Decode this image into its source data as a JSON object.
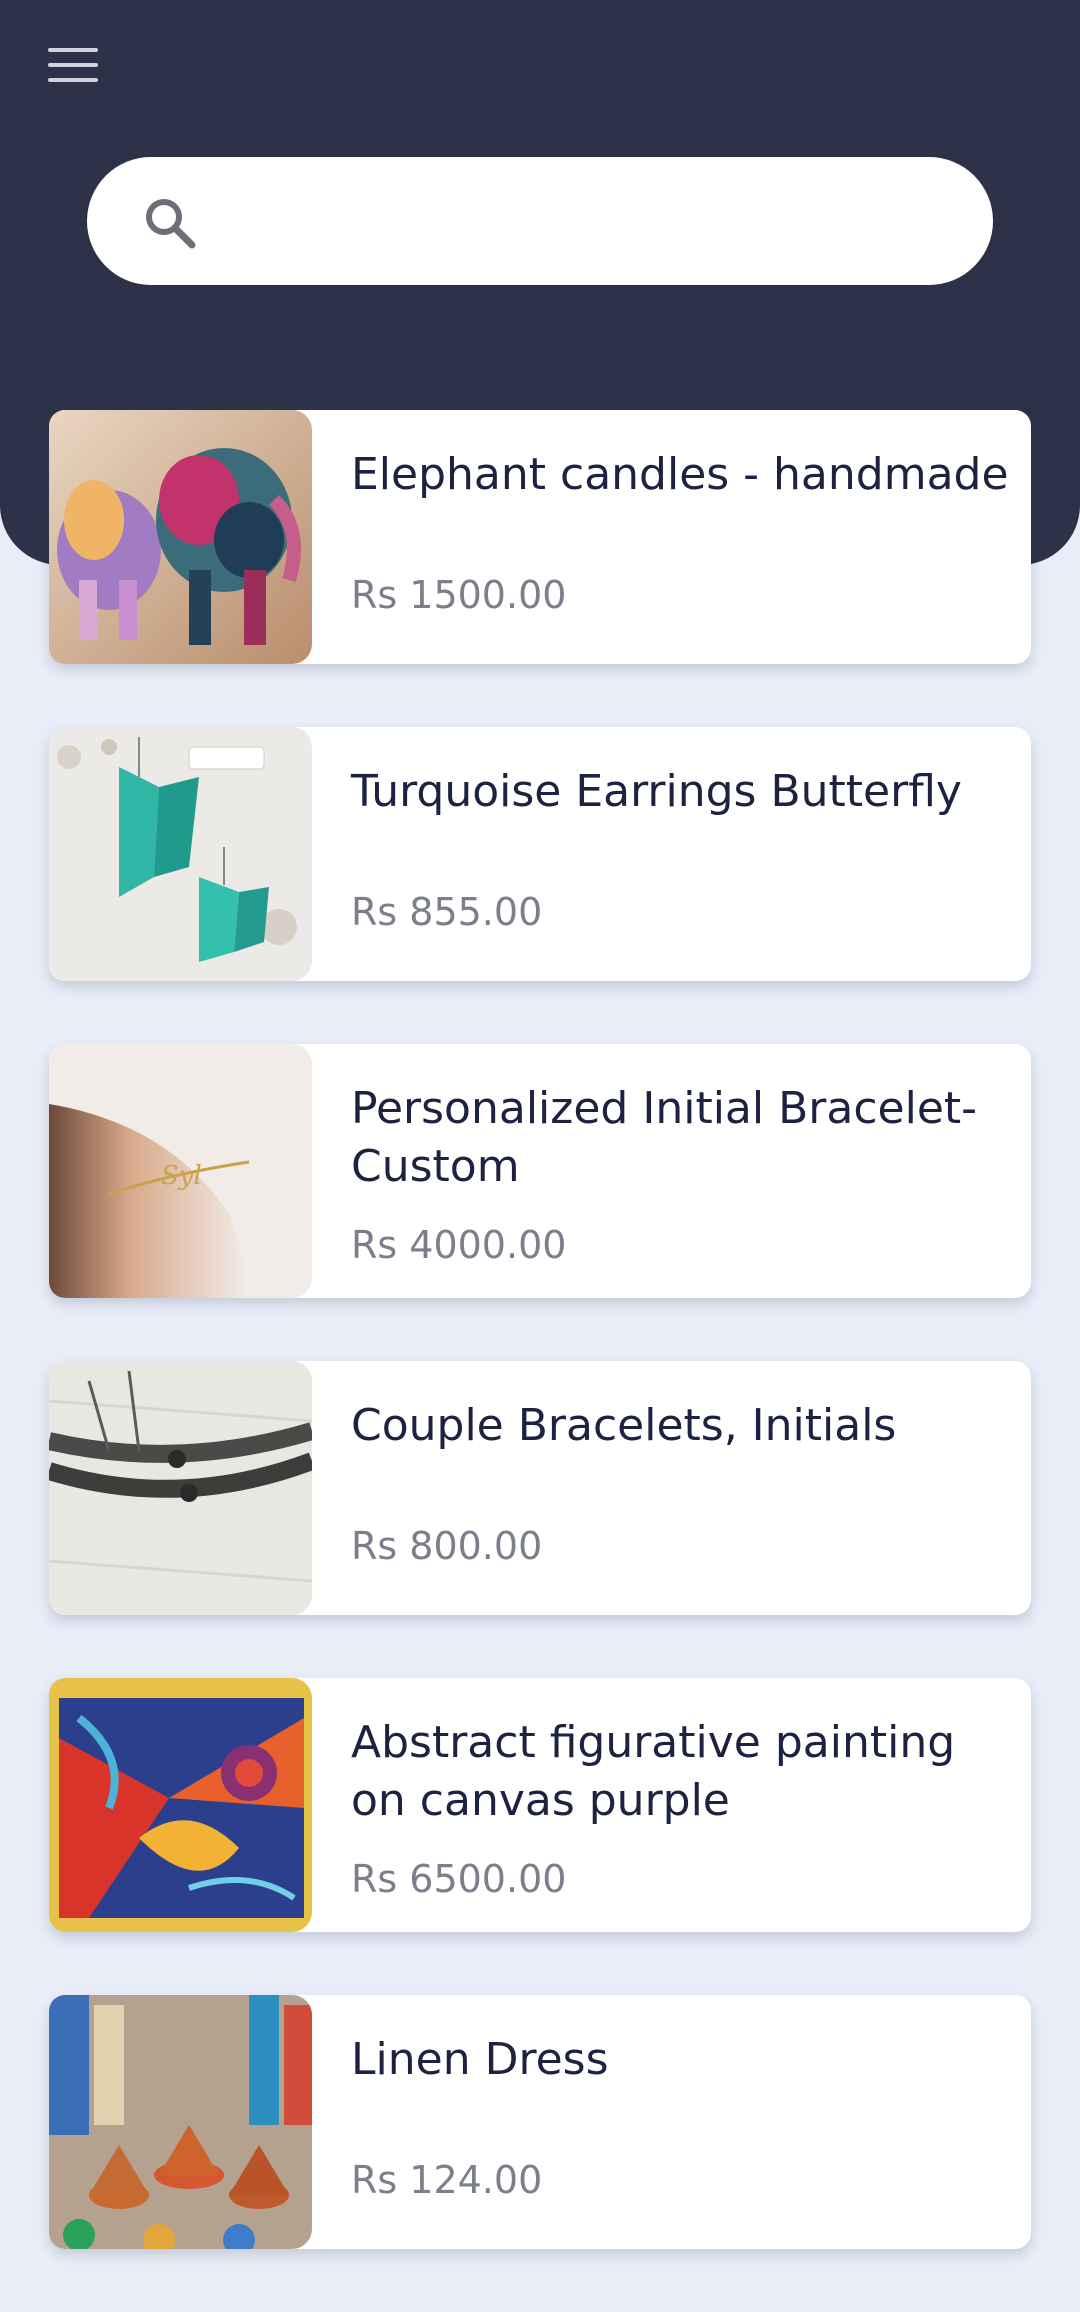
{
  "header": {
    "menu_icon": "menu-icon",
    "background_color": "#2d3249"
  },
  "search": {
    "icon": "search-icon",
    "value": ""
  },
  "products": [
    {
      "title": "Elephant candles - handmade",
      "price": "Rs 1500.00"
    },
    {
      "title": "Turquoise Earrings Butterfly",
      "price": "Rs 855.00"
    },
    {
      "title": "Personalized Initial Bracelet-Custom",
      "price": "Rs 4000.00"
    },
    {
      "title": "Couple Bracelets, Initials",
      "price": "Rs 800.00"
    },
    {
      "title": "Abstract figurative painting on canvas purple",
      "price": "Rs 6500.00"
    },
    {
      "title": "Linen Dress",
      "price": "Rs 124.00"
    }
  ]
}
